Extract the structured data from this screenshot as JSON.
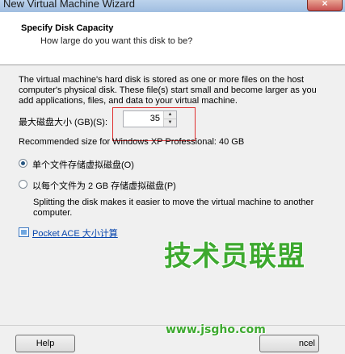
{
  "window": {
    "title": "New Virtual Machine Wizard",
    "close_glyph": "×"
  },
  "header": {
    "title": "Specify Disk Capacity",
    "subtitle": "How large do you want this disk to be?"
  },
  "content": {
    "description_lines": [
      "The virtual machine's hard disk is stored as one or more files on the host",
      "computer's physical disk. These file(s) start small and become larger as you",
      "add applications, files, and data to your virtual machine."
    ],
    "size_label": "最大磁盘大小 (GB)(S):",
    "size_value": "35",
    "recommended": "Recommended size for Windows XP Professional: 40 GB",
    "option_single": "单个文件存储虚拟磁盘(O)",
    "option_split": "以每个文件为 2 GB 存储虚拟磁盘(P)",
    "split_description_lines": [
      "Splitting the disk makes it easier to move the virtual machine to another",
      "computer."
    ],
    "link": "Pocket ACE 大小计算"
  },
  "footer": {
    "help_label": "Help",
    "finish_label": "ncel"
  },
  "watermark": {
    "brand": "技术员联盟",
    "url": "www.jsgho.com"
  },
  "colors": {
    "accent_red": "#e03030",
    "watermark_green": "#3da92f",
    "link_blue": "#0645ad"
  }
}
